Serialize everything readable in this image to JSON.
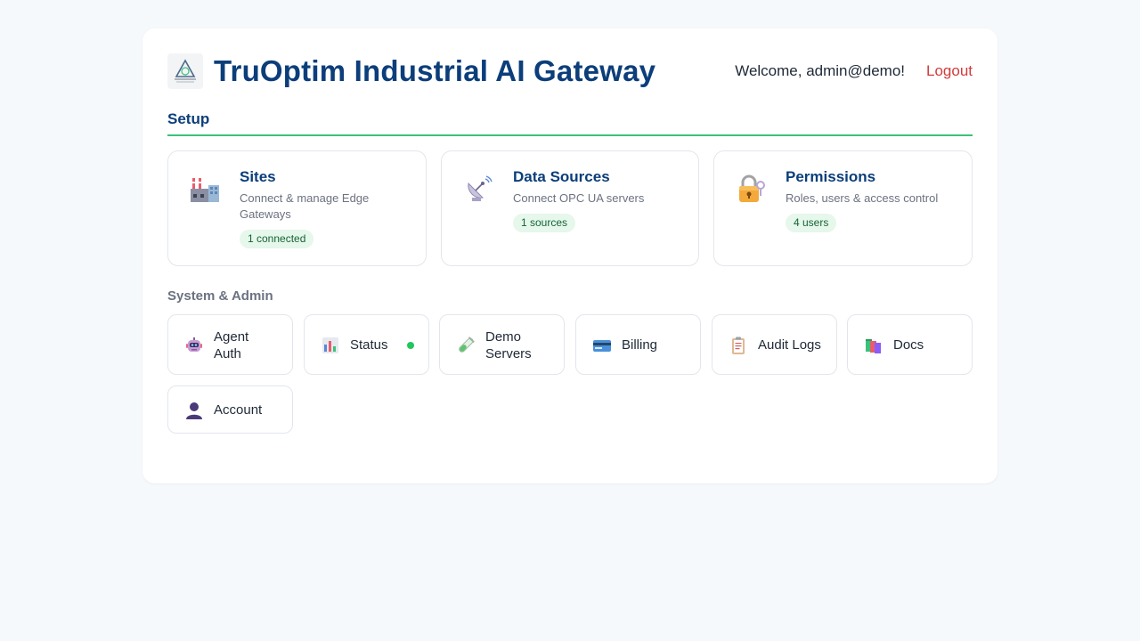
{
  "header": {
    "title": "TruOptim Industrial AI Gateway",
    "welcome": "Welcome, admin@demo!",
    "logout": "Logout"
  },
  "setup": {
    "heading": "Setup",
    "cards": [
      {
        "title": "Sites",
        "desc": "Connect & manage Edge Gateways",
        "badge": "1 connected",
        "icon": "factory-icon"
      },
      {
        "title": "Data Sources",
        "desc": "Connect OPC UA servers",
        "badge": "1 sources",
        "icon": "satellite-dish-icon"
      },
      {
        "title": "Permissions",
        "desc": "Roles, users & access control",
        "badge": "4 users",
        "icon": "lock-key-icon"
      }
    ]
  },
  "admin": {
    "heading": "System & Admin",
    "tiles": [
      {
        "label": "Agent Auth",
        "icon": "robot-icon"
      },
      {
        "label": "Status",
        "icon": "bar-chart-icon"
      },
      {
        "label": "Demo Servers",
        "icon": "test-tube-icon"
      },
      {
        "label": "Billing",
        "icon": "credit-card-icon"
      },
      {
        "label": "Audit Logs",
        "icon": "clipboard-icon"
      },
      {
        "label": "Docs",
        "icon": "books-icon"
      },
      {
        "label": "Account",
        "icon": "user-icon"
      }
    ]
  },
  "colors": {
    "brand": "#0b3e7a",
    "accent": "#3cc17a",
    "logout": "#d33b3b",
    "status_ok": "#22c55e"
  }
}
